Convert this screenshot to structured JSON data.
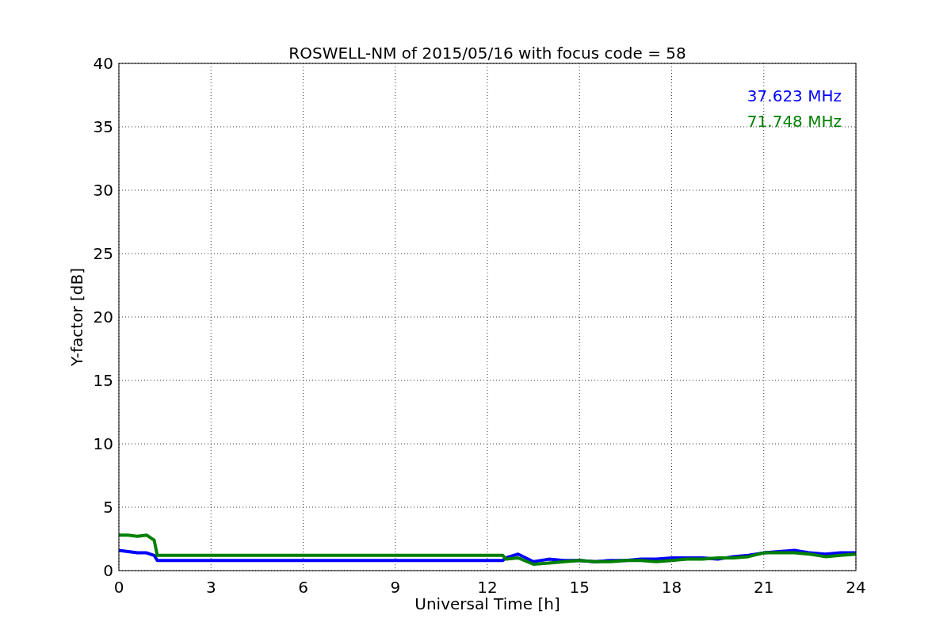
{
  "chart_data": {
    "type": "line",
    "title": "ROSWELL-NM of 2015/05/16 with focus code = 58",
    "xlabel": "Universal Time [h]",
    "ylabel": "Y-factor [dB]",
    "x": [
      0,
      0.3,
      0.6,
      0.9,
      1.15,
      1.25,
      6,
      12.5,
      12.6,
      13,
      13.5,
      14,
      14.5,
      15,
      15.5,
      16,
      16.5,
      17,
      17.5,
      18,
      18.5,
      19,
      19.5,
      20,
      20.5,
      21,
      21.5,
      22,
      22.5,
      23,
      23.5,
      24
    ],
    "series": [
      {
        "name": "37.623 MHz",
        "color": "#0000ff",
        "values": [
          1.6,
          1.5,
          1.4,
          1.4,
          1.2,
          0.8,
          0.8,
          0.8,
          1.0,
          1.3,
          0.7,
          0.9,
          0.8,
          0.8,
          0.7,
          0.8,
          0.8,
          0.9,
          0.9,
          1.0,
          1.0,
          1.0,
          0.9,
          1.1,
          1.2,
          1.4,
          1.5,
          1.6,
          1.4,
          1.3,
          1.4,
          1.4
        ]
      },
      {
        "name": "71.748 MHz",
        "color": "#008000",
        "values": [
          2.8,
          2.8,
          2.7,
          2.8,
          2.4,
          1.2,
          1.2,
          1.2,
          0.9,
          1.0,
          0.5,
          0.6,
          0.7,
          0.8,
          0.7,
          0.7,
          0.8,
          0.8,
          0.7,
          0.8,
          0.9,
          0.9,
          1.0,
          1.0,
          1.1,
          1.4,
          1.4,
          1.4,
          1.3,
          1.1,
          1.2,
          1.3
        ]
      }
    ],
    "grid": true,
    "xlim": [
      0,
      24
    ],
    "ylim": [
      0,
      40
    ],
    "xticks": [
      0,
      3,
      6,
      9,
      12,
      15,
      18,
      21,
      24
    ],
    "yticks": [
      0,
      5,
      10,
      15,
      20,
      25,
      30,
      35,
      40
    ]
  }
}
